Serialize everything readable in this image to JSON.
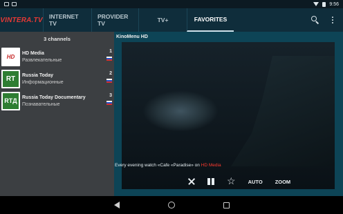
{
  "status_bar": {
    "time": "9:56"
  },
  "app": {
    "logo_text": "VINTERA.TV"
  },
  "tabs": [
    {
      "label": "INTERNET TV",
      "active": false
    },
    {
      "label": "PROVIDER TV",
      "active": false
    },
    {
      "label": "TV+",
      "active": false
    },
    {
      "label": "FAVORITES",
      "active": true
    }
  ],
  "top_actions": {
    "search_icon": "search-icon",
    "more_icon": "more-vert-icon"
  },
  "channels_panel": {
    "count_label": "3 channels",
    "channels": [
      {
        "logo": "HD",
        "name": "HD Media",
        "genre": "Развлекательные",
        "number": "1"
      },
      {
        "logo": "RT",
        "name": "Russia Today",
        "genre": "Информационные",
        "number": "2"
      },
      {
        "logo": "RTД",
        "name": "Russia Today Documentary",
        "genre": "Познавательные",
        "number": "3"
      }
    ]
  },
  "player": {
    "title": "KinoMenu HD",
    "auto_label": "AUTO",
    "zoom_label": "ZOOM",
    "caption_text": "Every evening watch «Cafe «Paradise» on ",
    "caption_link": "HD Media"
  },
  "colors": {
    "topbar": "#0f2d3b",
    "left_panel": "#3c3f42",
    "content_bg": "#0d4456",
    "accent_red": "#ff3b30"
  }
}
